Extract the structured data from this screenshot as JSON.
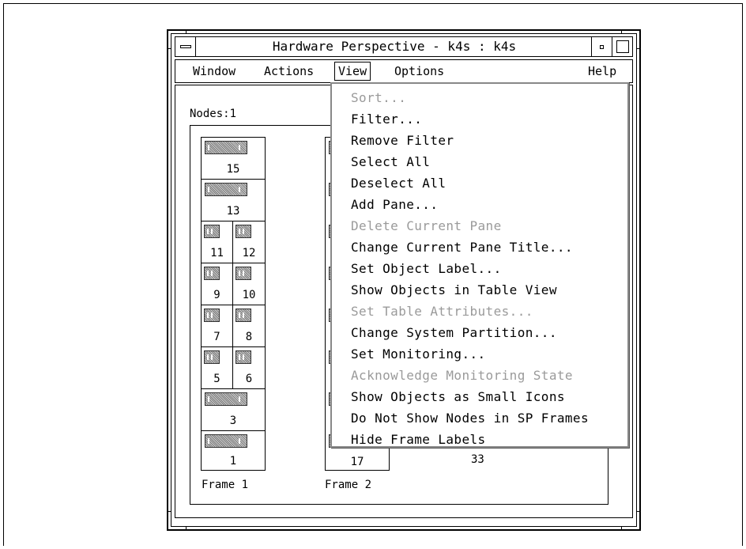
{
  "window": {
    "title": "Hardware Perspective - k4s : k4s"
  },
  "menubar": {
    "window": "Window",
    "actions": "Actions",
    "view": "View",
    "options": "Options",
    "help": "Help"
  },
  "content": {
    "nodes_label": "Nodes:1",
    "frame1": {
      "label": "Frame 1",
      "rows": [
        {
          "type": "wide",
          "num": "15"
        },
        {
          "type": "wide",
          "num": "13"
        },
        {
          "type": "pair",
          "left": "11",
          "right": "12"
        },
        {
          "type": "pair",
          "left": "9",
          "right": "10"
        },
        {
          "type": "pair",
          "left": "7",
          "right": "8"
        },
        {
          "type": "pair",
          "left": "5",
          "right": "6"
        },
        {
          "type": "wide",
          "num": "3"
        },
        {
          "type": "wide",
          "num": "1"
        }
      ]
    },
    "frame2": {
      "label": "Frame 2",
      "bottom_node": "17"
    },
    "node_33": "33"
  },
  "view_menu": {
    "items": [
      {
        "label": "Sort...",
        "enabled": false
      },
      {
        "label": "Filter...",
        "enabled": true
      },
      {
        "label": "Remove Filter",
        "enabled": true
      },
      {
        "label": "Select All",
        "enabled": true
      },
      {
        "label": "Deselect All",
        "enabled": true
      },
      {
        "label": "Add Pane...",
        "enabled": true
      },
      {
        "label": "Delete Current Pane",
        "enabled": false
      },
      {
        "label": "Change Current Pane Title...",
        "enabled": true
      },
      {
        "label": "Set Object Label...",
        "enabled": true
      },
      {
        "label": "Show Objects in Table View",
        "enabled": true
      },
      {
        "label": "Set Table Attributes...",
        "enabled": false
      },
      {
        "label": "Change System Partition...",
        "enabled": true
      },
      {
        "label": "Set Monitoring...",
        "enabled": true
      },
      {
        "label": "Acknowledge Monitoring State",
        "enabled": false
      },
      {
        "label": "Show Objects as Small Icons",
        "enabled": true
      },
      {
        "label": "Do Not Show Nodes in SP Frames",
        "enabled": true
      },
      {
        "label": "Hide Frame Labels",
        "enabled": true
      }
    ]
  },
  "colors": {
    "disabled_text": "#9a9a9a",
    "node_icon": "#a0a0a0"
  }
}
